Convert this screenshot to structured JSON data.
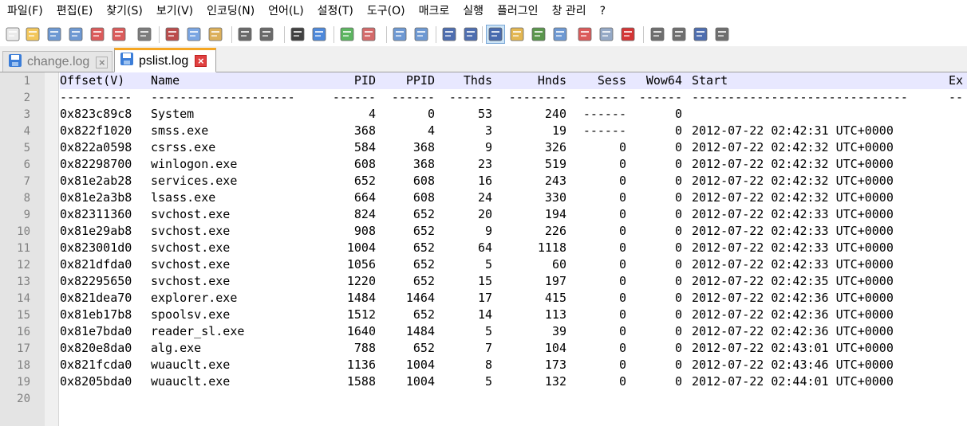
{
  "menu": [
    "파일(F)",
    "편집(E)",
    "찾기(S)",
    "보기(V)",
    "인코딩(N)",
    "언어(L)",
    "설정(T)",
    "도구(O)",
    "매크로",
    "실행",
    "플러그인",
    "창 관리",
    "?"
  ],
  "toolbar_icons": [
    "new-file-icon",
    "open-folder-icon",
    "save-icon",
    "save-all-icon",
    "close-icon",
    "close-all-icon",
    "print-icon",
    "cut-icon",
    "copy-icon",
    "paste-icon",
    "undo-icon",
    "redo-icon",
    "find-icon",
    "replace-icon",
    "zoom-in-icon",
    "zoom-out-icon",
    "sync-vertical-icon",
    "sync-horizontal-icon",
    "word-wrap-icon",
    "show-all-chars-icon",
    "indent-guide-icon",
    "user-language-icon",
    "doc-map-icon",
    "function-list-icon",
    "folder-workspace-icon",
    "monitor-icon",
    "record-macro-icon",
    "stop-macro-icon",
    "play-macro-icon",
    "run-macro-multiple-icon",
    "save-macro-icon"
  ],
  "tabs": [
    {
      "label": "change.log",
      "active": false
    },
    {
      "label": "pslist.log",
      "active": true
    }
  ],
  "header": {
    "offset": "Offset(V)",
    "name": "Name",
    "pid": "PID",
    "ppid": "PPID",
    "thds": "Thds",
    "hnds": "Hnds",
    "sess": "Sess",
    "wow64": "Wow64",
    "start": "Start",
    "exit": "Ex"
  },
  "separator": {
    "offset": "----------",
    "name": "--------------------",
    "pid": "------",
    "ppid": "------",
    "thds": "------",
    "hnds": "--------",
    "sess": "------",
    "wow64": "------",
    "start": "------------------------------",
    "exit": "--"
  },
  "rows": [
    {
      "offset": "0x823c89c8",
      "name": "System",
      "pid": "4",
      "ppid": "0",
      "thds": "53",
      "hnds": "240",
      "sess": "------",
      "wow64": "0",
      "start": ""
    },
    {
      "offset": "0x822f1020",
      "name": "smss.exe",
      "pid": "368",
      "ppid": "4",
      "thds": "3",
      "hnds": "19",
      "sess": "------",
      "wow64": "0",
      "start": "2012-07-22 02:42:31 UTC+0000"
    },
    {
      "offset": "0x822a0598",
      "name": "csrss.exe",
      "pid": "584",
      "ppid": "368",
      "thds": "9",
      "hnds": "326",
      "sess": "0",
      "wow64": "0",
      "start": "2012-07-22 02:42:32 UTC+0000"
    },
    {
      "offset": "0x82298700",
      "name": "winlogon.exe",
      "pid": "608",
      "ppid": "368",
      "thds": "23",
      "hnds": "519",
      "sess": "0",
      "wow64": "0",
      "start": "2012-07-22 02:42:32 UTC+0000"
    },
    {
      "offset": "0x81e2ab28",
      "name": "services.exe",
      "pid": "652",
      "ppid": "608",
      "thds": "16",
      "hnds": "243",
      "sess": "0",
      "wow64": "0",
      "start": "2012-07-22 02:42:32 UTC+0000"
    },
    {
      "offset": "0x81e2a3b8",
      "name": "lsass.exe",
      "pid": "664",
      "ppid": "608",
      "thds": "24",
      "hnds": "330",
      "sess": "0",
      "wow64": "0",
      "start": "2012-07-22 02:42:32 UTC+0000"
    },
    {
      "offset": "0x82311360",
      "name": "svchost.exe",
      "pid": "824",
      "ppid": "652",
      "thds": "20",
      "hnds": "194",
      "sess": "0",
      "wow64": "0",
      "start": "2012-07-22 02:42:33 UTC+0000"
    },
    {
      "offset": "0x81e29ab8",
      "name": "svchost.exe",
      "pid": "908",
      "ppid": "652",
      "thds": "9",
      "hnds": "226",
      "sess": "0",
      "wow64": "0",
      "start": "2012-07-22 02:42:33 UTC+0000"
    },
    {
      "offset": "0x823001d0",
      "name": "svchost.exe",
      "pid": "1004",
      "ppid": "652",
      "thds": "64",
      "hnds": "1118",
      "sess": "0",
      "wow64": "0",
      "start": "2012-07-22 02:42:33 UTC+0000"
    },
    {
      "offset": "0x821dfda0",
      "name": "svchost.exe",
      "pid": "1056",
      "ppid": "652",
      "thds": "5",
      "hnds": "60",
      "sess": "0",
      "wow64": "0",
      "start": "2012-07-22 02:42:33 UTC+0000"
    },
    {
      "offset": "0x82295650",
      "name": "svchost.exe",
      "pid": "1220",
      "ppid": "652",
      "thds": "15",
      "hnds": "197",
      "sess": "0",
      "wow64": "0",
      "start": "2012-07-22 02:42:35 UTC+0000"
    },
    {
      "offset": "0x821dea70",
      "name": "explorer.exe",
      "pid": "1484",
      "ppid": "1464",
      "thds": "17",
      "hnds": "415",
      "sess": "0",
      "wow64": "0",
      "start": "2012-07-22 02:42:36 UTC+0000"
    },
    {
      "offset": "0x81eb17b8",
      "name": "spoolsv.exe",
      "pid": "1512",
      "ppid": "652",
      "thds": "14",
      "hnds": "113",
      "sess": "0",
      "wow64": "0",
      "start": "2012-07-22 02:42:36 UTC+0000"
    },
    {
      "offset": "0x81e7bda0",
      "name": "reader_sl.exe",
      "pid": "1640",
      "ppid": "1484",
      "thds": "5",
      "hnds": "39",
      "sess": "0",
      "wow64": "0",
      "start": "2012-07-22 02:42:36 UTC+0000"
    },
    {
      "offset": "0x820e8da0",
      "name": "alg.exe",
      "pid": "788",
      "ppid": "652",
      "thds": "7",
      "hnds": "104",
      "sess": "0",
      "wow64": "0",
      "start": "2012-07-22 02:43:01 UTC+0000"
    },
    {
      "offset": "0x821fcda0",
      "name": "wuauclt.exe",
      "pid": "1136",
      "ppid": "1004",
      "thds": "8",
      "hnds": "173",
      "sess": "0",
      "wow64": "0",
      "start": "2012-07-22 02:43:46 UTC+0000"
    },
    {
      "offset": "0x8205bda0",
      "name": "wuauclt.exe",
      "pid": "1588",
      "ppid": "1004",
      "thds": "5",
      "hnds": "132",
      "sess": "0",
      "wow64": "0",
      "start": "2012-07-22 02:44:01 UTC+0000"
    }
  ],
  "line_numbers": [
    "1",
    "2",
    "3",
    "4",
    "5",
    "6",
    "7",
    "8",
    "9",
    "10",
    "11",
    "12",
    "13",
    "14",
    "15",
    "16",
    "17",
    "18",
    "19",
    "20"
  ],
  "colors": {
    "current_line": "#e8e8ff",
    "gutter": "#e4e4e4",
    "active_tab_accent": "#f5a623",
    "close_button": "#e04040"
  }
}
